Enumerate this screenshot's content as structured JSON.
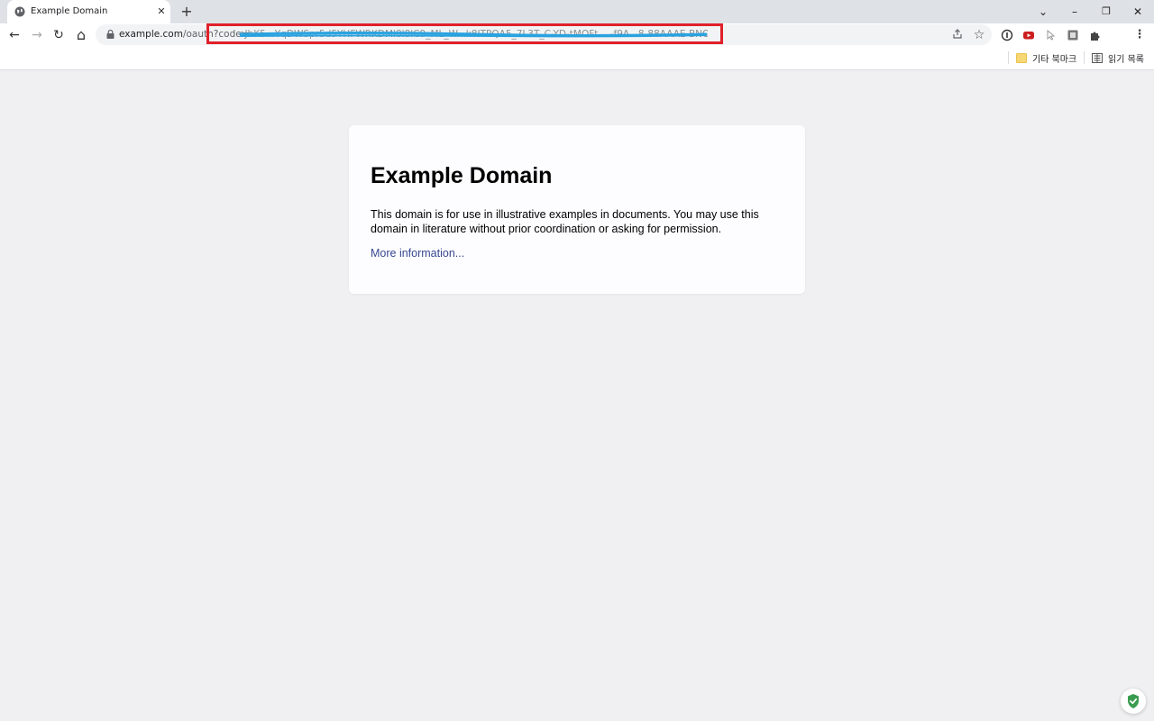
{
  "tab": {
    "title": "Example Domain",
    "close": "✕",
    "new_tab": "+"
  },
  "window": {
    "dropdown": "⌄",
    "minimize": "–",
    "restore": "❐",
    "close": "✕"
  },
  "toolbar": {
    "back": "←",
    "forward": "→",
    "reload": "↻",
    "home": "⌂",
    "url_host": "example.com",
    "url_path": "/oauth",
    "url_query_prefix": "?code=",
    "url_code_redacted": "eJhK5...YqDWSpr5d5YHFWRKDMl8l8lC9_ML_W...k8ITPQA5_7L3T_C-YD-tMOFt....-f9A...8-88AAAE-BNO4-Q"
  },
  "colors": {
    "highlight_box": "#e0202a",
    "redaction_line": "#29a3e0",
    "link": "#38488f"
  },
  "bookmarks": {
    "other": "기타 북마크",
    "reading_list": "읽기 목록"
  },
  "page": {
    "heading": "Example Domain",
    "paragraph": "This domain is for use in illustrative examples in documents. You may use this domain in literature without prior coordination or asking for permission.",
    "link": "More information..."
  }
}
